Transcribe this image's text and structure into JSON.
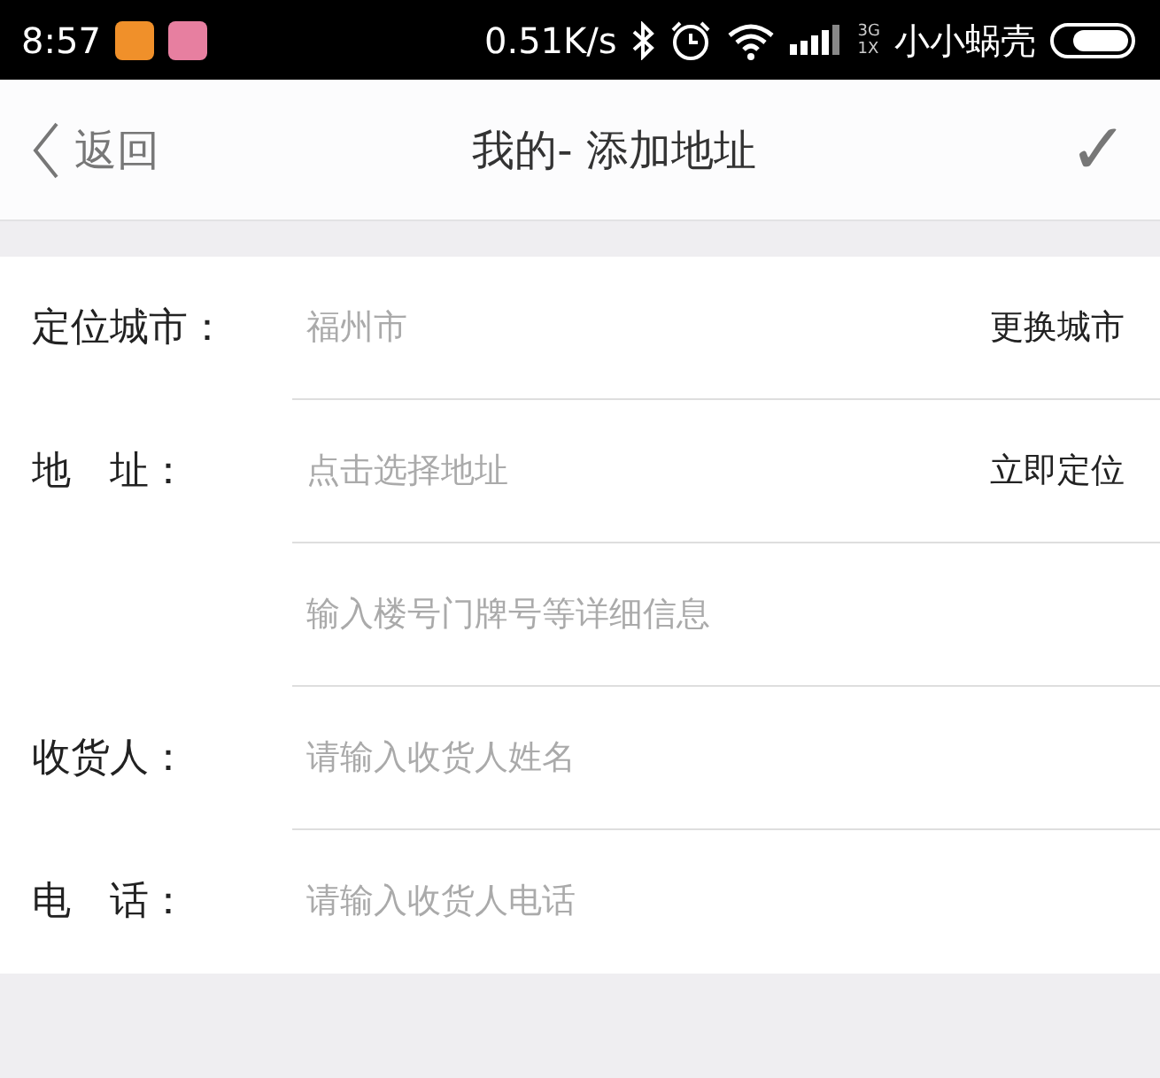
{
  "status_bar": {
    "time": "8:57",
    "speed": "0.51K/s",
    "network_top": "3G",
    "network_bottom": "1X",
    "carrier": "小小蜗壳"
  },
  "nav": {
    "back": "返回",
    "title": "我的- 添加地址",
    "confirm": "✓"
  },
  "form": [
    {
      "label": "定位城市：",
      "placeholder": "福州市",
      "action": "更换城市"
    },
    {
      "label": "地　址：",
      "placeholder": "点击选择地址",
      "action": "立即定位"
    },
    {
      "placeholder": "输入楼号门牌号等详细信息"
    },
    {
      "label": "收货人：",
      "placeholder": "请输入收货人姓名"
    },
    {
      "label": "电　话：",
      "placeholder": "请输入收货人电话"
    }
  ]
}
